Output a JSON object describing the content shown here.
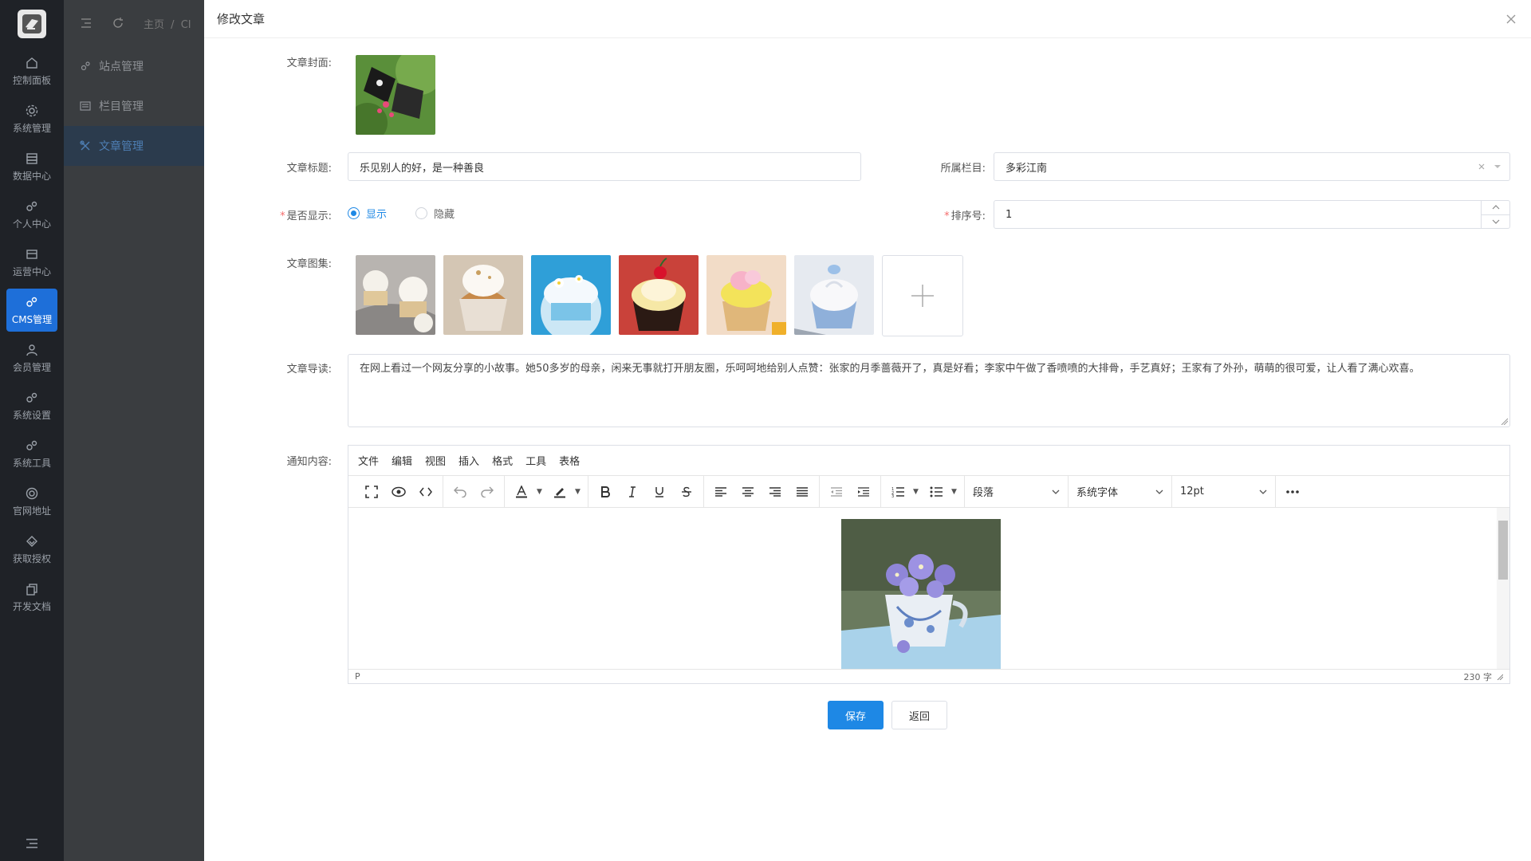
{
  "sidebar": {
    "items": [
      {
        "label": "控制面板"
      },
      {
        "label": "系统管理"
      },
      {
        "label": "数据中心"
      },
      {
        "label": "个人中心"
      },
      {
        "label": "运营中心"
      },
      {
        "label": "CMS管理"
      },
      {
        "label": "会员管理"
      },
      {
        "label": "系统设置"
      },
      {
        "label": "系统工具"
      },
      {
        "label": "官网地址"
      },
      {
        "label": "获取授权"
      },
      {
        "label": "开发文档"
      }
    ]
  },
  "header": {
    "home": "主页",
    "sep": "/",
    "crumb": "CI"
  },
  "submenu": {
    "items": [
      {
        "label": "站点管理"
      },
      {
        "label": "栏目管理"
      },
      {
        "label": "文章管理"
      }
    ]
  },
  "modal": {
    "title": "修改文章"
  },
  "form": {
    "cover_label": "文章封面:",
    "title_label": "文章标题:",
    "title_value": "乐见别人的好，是一种善良",
    "column_label": "所属栏目:",
    "column_value": "多彩江南",
    "show_label": "是否显示:",
    "show_yes": "显示",
    "show_no": "隐藏",
    "sort_label": "排序号:",
    "sort_value": "1",
    "gallery_label": "文章图集:",
    "intro_label": "文章导读:",
    "intro_value": "在网上看过一个网友分享的小故事。她50多岁的母亲，闲来无事就打开朋友圈，乐呵呵地给别人点赞：张家的月季蔷薇开了，真是好看；李家中午做了香喷喷的大排骨，手艺真好；王家有了外孙，萌萌的很可爱，让人看了满心欢喜。",
    "content_label": "通知内容:"
  },
  "editor": {
    "menus": [
      "文件",
      "编辑",
      "视图",
      "插入",
      "格式",
      "工具",
      "表格"
    ],
    "block_format": "段落",
    "font_family": "系统字体",
    "font_size": "12pt",
    "status_path": "P",
    "word_count": "230 字"
  },
  "actions": {
    "save": "保存",
    "back": "返回"
  },
  "colors": {
    "primary": "#1e88e5",
    "sidebar_bg": "#1f2227",
    "required": "#f56c6c"
  }
}
